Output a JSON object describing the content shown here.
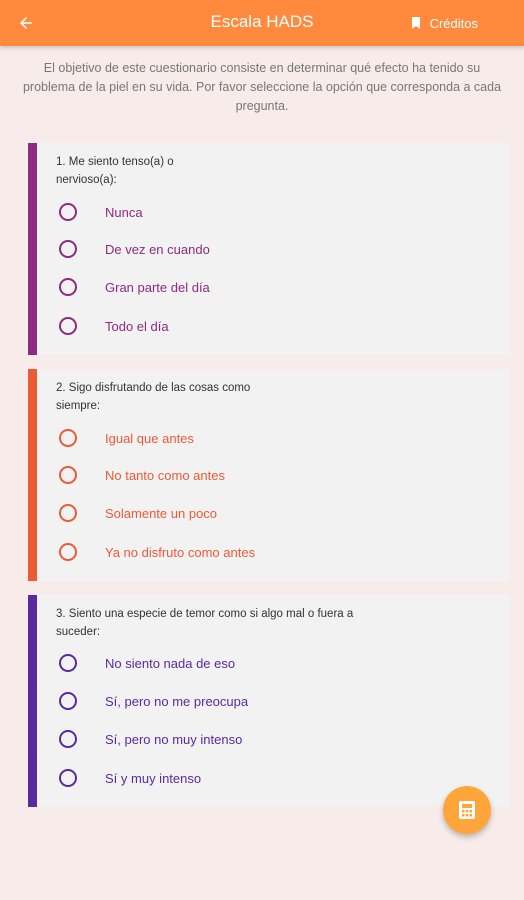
{
  "appbar": {
    "title": "Escala HADS",
    "credits_label": "Créditos",
    "back_icon": "arrow-back-icon",
    "credits_icon": "bookmark-icon"
  },
  "intro": "El objetivo de este cuestionario consiste en determinar qué efecto ha tenido su problema de la piel en su vida. Por favor seleccione la opción que corresponda a cada pregunta.",
  "questions": [
    {
      "text_line1": "1. Me siento tenso(a) o",
      "text_line2": "nervioso(a):",
      "color": "#8e2a7f",
      "options": [
        "Nunca",
        "De vez en cuando",
        "Gran parte del día",
        "Todo el día"
      ]
    },
    {
      "text_line1": "2. Sigo disfrutando de las cosas como",
      "text_line2": "siempre:",
      "color": "#ee5a36",
      "options": [
        "Igual que antes",
        "No tanto como antes",
        "Solamente un poco",
        "Ya no disfruto como antes"
      ]
    },
    {
      "text_line1": "3. Siento una especie de temor como si algo mal o fuera a",
      "text_line2": "suceder:",
      "color": "#5a2aa0",
      "options": [
        "No siento nada de eso",
        "Sí, pero no me preocupa",
        "Sí, pero no muy intenso",
        "Sí y muy intenso"
      ]
    }
  ],
  "fab": {
    "icon": "calculator-icon"
  }
}
